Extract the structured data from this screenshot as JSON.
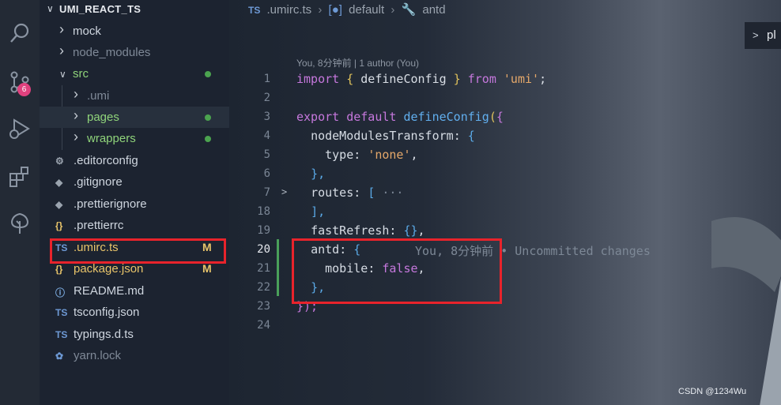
{
  "activity_bar": {
    "items": [
      {
        "name": "search",
        "icon": "search-icon"
      },
      {
        "name": "source-control",
        "icon": "source-control-icon",
        "badge": "6"
      },
      {
        "name": "run-debug",
        "icon": "debug-icon"
      },
      {
        "name": "extensions",
        "icon": "extensions-icon"
      },
      {
        "name": "remote",
        "icon": "tree-icon"
      }
    ]
  },
  "sidebar": {
    "title": "UMI_REACT_TS",
    "items": [
      {
        "label": "mock",
        "type": "folder",
        "expanded": false,
        "color": "#cfd6df",
        "status": ""
      },
      {
        "label": "node_modules",
        "type": "folder",
        "expanded": false,
        "color": "#7f8997",
        "status": ""
      },
      {
        "label": "src",
        "type": "folder",
        "expanded": true,
        "color": "#8fd37a",
        "status": "dot"
      },
      {
        "label": ".umi",
        "type": "folder",
        "expanded": false,
        "color": "#7f8997",
        "status": ""
      },
      {
        "label": "pages",
        "type": "folder",
        "expanded": false,
        "color": "#8fd37a",
        "status": "dot"
      },
      {
        "label": "wrappers",
        "type": "folder",
        "expanded": false,
        "color": "#8fd37a",
        "status": "dot"
      },
      {
        "label": ".editorconfig",
        "type": "file",
        "icon": "gear-icon",
        "color": "#cfd6df",
        "status": ""
      },
      {
        "label": ".gitignore",
        "type": "file",
        "icon": "git-icon",
        "color": "#cfd6df",
        "status": ""
      },
      {
        "label": ".prettierignore",
        "type": "file",
        "icon": "prettier-icon",
        "color": "#cfd6df",
        "status": ""
      },
      {
        "label": ".prettierrc",
        "type": "file",
        "icon": "braces-icon",
        "color": "#cfd6df",
        "status": ""
      },
      {
        "label": ".umirc.ts",
        "type": "file",
        "icon": "ts-icon",
        "color": "#e8c46a",
        "status": "M"
      },
      {
        "label": "package.json",
        "type": "file",
        "icon": "braces-icon",
        "color": "#e8c46a",
        "status": "M"
      },
      {
        "label": "README.md",
        "type": "file",
        "icon": "info-icon",
        "color": "#cfd6df",
        "status": ""
      },
      {
        "label": "tsconfig.json",
        "type": "file",
        "icon": "ts-icon",
        "color": "#cfd6df",
        "status": ""
      },
      {
        "label": "typings.d.ts",
        "type": "file",
        "icon": "ts-icon",
        "color": "#cfd6df",
        "status": ""
      },
      {
        "label": "yarn.lock",
        "type": "file",
        "icon": "yarn-icon",
        "color": "#7f8997",
        "status": ""
      }
    ]
  },
  "editor": {
    "breadcrumb": {
      "file_icon": "TS",
      "file": ".umirc.ts",
      "symbol1": "default",
      "symbol2": "antd"
    },
    "minimap_button": {
      "chevron": ">",
      "text": "pl"
    },
    "codelens": "You, 8分钟前 | 1 author (You)",
    "blame": "You, 8分钟前 • Uncommitted changes",
    "line_numbers": [
      "1",
      "2",
      "3",
      "4",
      "5",
      "6",
      "7",
      "18",
      "19",
      "20",
      "21",
      "22",
      "23",
      "24"
    ],
    "active_line": "20",
    "code_tokens": {
      "import": "import",
      "lbrace": "{",
      "defineConfig": "defineConfig",
      "rbrace": "}",
      "from": "from",
      "umi": "'umi'",
      "semi": ";",
      "export": "export",
      "default": "default",
      "paren_open": "(",
      "obj_open": "{",
      "nodeModulesTransform": "nodeModulesTransform",
      "colon": ":",
      "type": "type",
      "none": "'none'",
      "comma": ",",
      "close_obj_comma": "},",
      "routes": "routes",
      "arr_open": "[",
      "ellipsis": "···",
      "close_arr_comma": "],",
      "fastRefresh": "fastRefresh",
      "empty_obj": "{}",
      "antd": "antd",
      "mobile": "mobile",
      "false": "false",
      "close_all": "});"
    }
  },
  "watermark": "CSDN @1234Wu"
}
